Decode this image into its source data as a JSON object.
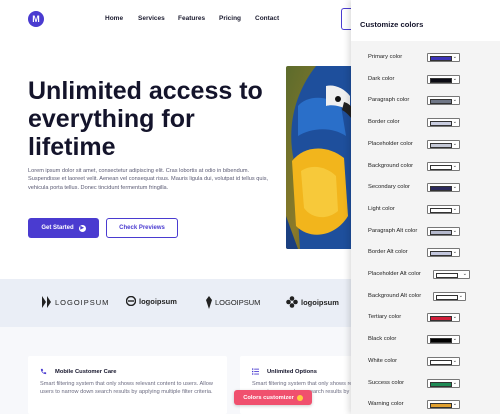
{
  "brand": {
    "logo_letter": "M"
  },
  "nav": {
    "items": [
      "Home",
      "Services",
      "Features",
      "Pricing",
      "Contact"
    ]
  },
  "hero": {
    "title_lines": [
      "Unlimited access to",
      "everything for",
      "lifetime"
    ],
    "text": "Lorem ipsum dolor sit amet, consectetur adipiscing elit. Cras lobortis at odio in bibendum. Suspendisse et laoreet velit. Aenean vel consequat risus. Mauris ligula dui, volutpat id tellus quis, vehicula porta tellus. Donec tincidunt fermentum fringilla.",
    "primary_button": "Get Started",
    "secondary_button": "Check Previews"
  },
  "logos": [
    "LOGOIPSUM",
    "logoipsum",
    "LOGOIPSUM",
    "logoipsum"
  ],
  "features": [
    {
      "title": "Mobile Customer Care",
      "text": "Smart filtering system that only shows relevant content to users. Allow users to narrow down search results by applying multiple filter criteria.",
      "icon": "phone-icon"
    },
    {
      "title": "Unlimited Options",
      "text": "Smart filtering system that only shows relevant content to users. Allow users to narrow down search results by applying multiple filter criteria.",
      "icon": "list-icon"
    }
  ],
  "customizer_button": "Colors customizer",
  "panel": {
    "title": "Customize colors",
    "rows": [
      {
        "label": "Primary color",
        "color": "#3d34b8"
      },
      {
        "label": "Dark color",
        "color": "#0b0b14"
      },
      {
        "label": "Paragraph color",
        "color": "#6f7686"
      },
      {
        "label": "Border color",
        "color": "#c9cde0"
      },
      {
        "label": "Placeholder color",
        "color": "#c4c8d6"
      },
      {
        "label": "Background color",
        "color": "#ffffff"
      },
      {
        "label": "Secondary color",
        "color": "#2c2a5c"
      },
      {
        "label": "Light color",
        "color": "#ffffff"
      },
      {
        "label": "Paragraph Alt color",
        "color": "#b4b8cc"
      },
      {
        "label": "Border Alt color",
        "color": "#c3c7de"
      },
      {
        "label": "Placeholder Alt color",
        "color": "#ffffff"
      },
      {
        "label": "Background Alt color",
        "color": "#ffffff"
      },
      {
        "label": "Tertiary color",
        "color": "#d11f3a"
      },
      {
        "label": "Black color",
        "color": "#000000"
      },
      {
        "label": "White color",
        "color": "#ffffff"
      },
      {
        "label": "Success color",
        "color": "#1f8a55"
      },
      {
        "label": "Warning color",
        "color": "#e0a030"
      }
    ]
  },
  "colors": {
    "accent": "#4a3bd0",
    "customizer_button": "#f0506e",
    "logo_strip_bg": "#eaeef6"
  }
}
